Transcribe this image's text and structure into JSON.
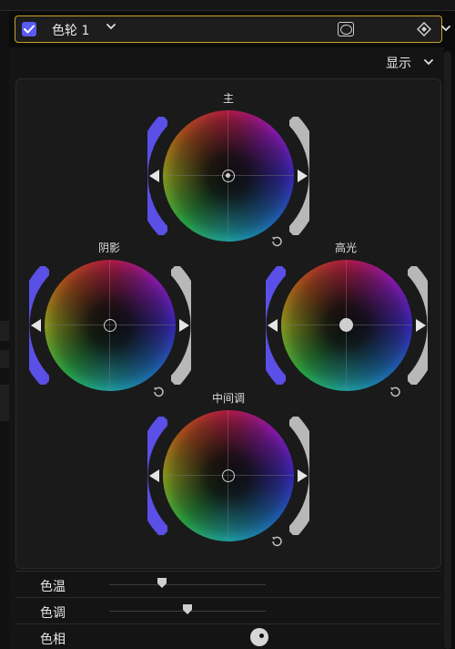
{
  "header": {
    "enabled": true,
    "effect_name": "色轮 1"
  },
  "display_menu": {
    "label": "显示"
  },
  "wheels": [
    {
      "id": "master",
      "label": "主"
    },
    {
      "id": "shadows",
      "label": "阴影"
    },
    {
      "id": "highlights",
      "label": "高光"
    },
    {
      "id": "midtones",
      "label": "中间调"
    }
  ],
  "sliders": {
    "temperature": {
      "label": "色温",
      "value_fraction": 0.34
    },
    "tint": {
      "label": "色调",
      "value_fraction": 0.5
    },
    "hue": {
      "label": "色相"
    }
  },
  "colors": {
    "accent_border": "#c9a227",
    "checkbox": "#5b5bf2",
    "saturation_arc": "#5a4fe6",
    "brightness_arc": "#b8b8b8"
  },
  "icons": [
    "checkmark-icon",
    "chevron-down-icon",
    "mask-icon",
    "keyframe-icon",
    "reset-icon"
  ]
}
